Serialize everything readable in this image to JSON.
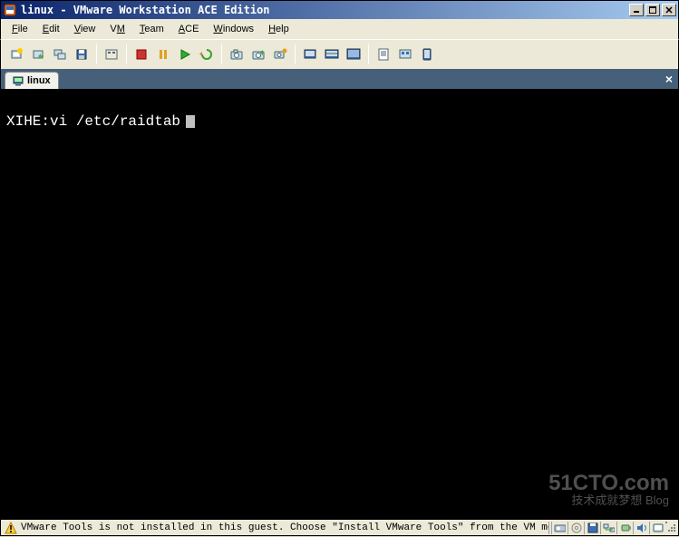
{
  "window": {
    "title": "linux - VMware Workstation ACE Edition"
  },
  "menu": {
    "items": [
      {
        "label": "File",
        "accel": "F"
      },
      {
        "label": "Edit",
        "accel": "E"
      },
      {
        "label": "View",
        "accel": "V"
      },
      {
        "label": "VM",
        "accel": "V"
      },
      {
        "label": "Team",
        "accel": "T"
      },
      {
        "label": "ACE",
        "accel": "A"
      },
      {
        "label": "Windows",
        "accel": "W"
      },
      {
        "label": "Help",
        "accel": "H"
      }
    ]
  },
  "tabs": {
    "active": {
      "label": "linux"
    }
  },
  "console": {
    "line1": "XIHE:vi /etc/raidtab"
  },
  "status": {
    "message": "VMware Tools is not installed in this guest. Choose \"Install VMware Tools\" from the VM me"
  },
  "watermark": {
    "top": "51CTO.com",
    "bottom": "技术成就梦想 Blog"
  }
}
